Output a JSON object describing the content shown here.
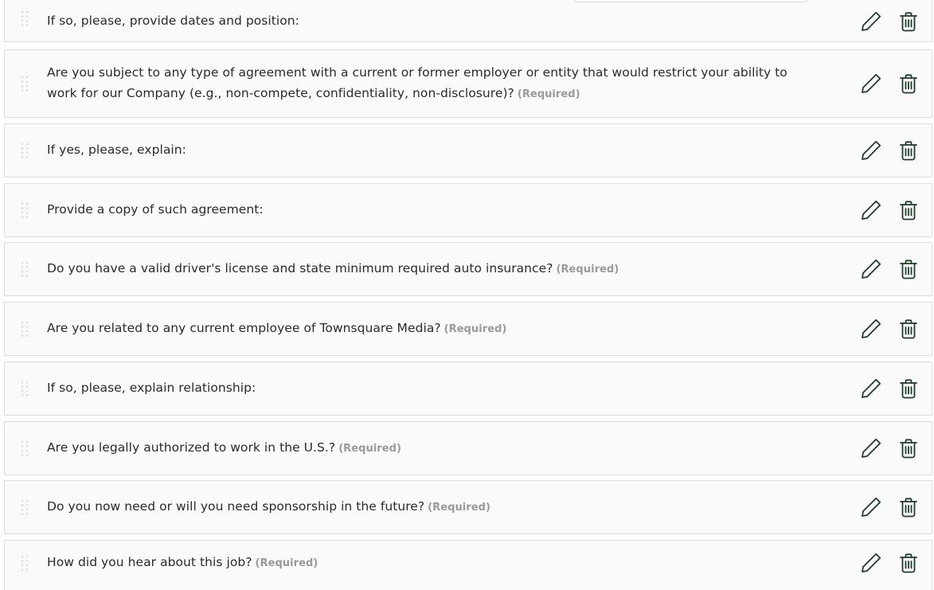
{
  "questions": [
    {
      "text": "If so, please, provide dates and position:",
      "required": ""
    },
    {
      "text": "Are you subject to any type of agreement with a current or former employer or entity that would restrict your ability to work for our Company (e.g., non-compete, confidentiality, non-disclosure)?",
      "required": "(Required)"
    },
    {
      "text": "If yes, please, explain:",
      "required": ""
    },
    {
      "text": "Provide a copy of such agreement:",
      "required": ""
    },
    {
      "text": "Do you have a valid driver's license and state minimum required auto insurance?",
      "required": "(Required)"
    },
    {
      "text": "Are you related to any current employee of Townsquare Media?",
      "required": "(Required)"
    },
    {
      "text": "If so, please, explain relationship:",
      "required": ""
    },
    {
      "text": "Are you legally authorized to work in the U.S.?",
      "required": "(Required)"
    },
    {
      "text": "Do you now need or will you need sponsorship in the future?",
      "required": "(Required)"
    },
    {
      "text": "How did you hear about this job?",
      "required": "(Required)"
    }
  ],
  "icons": {
    "drag": "drag-handle-icon",
    "edit": "pencil-icon",
    "delete": "trash-icon"
  },
  "colors": {
    "icon": "#1f3d2b",
    "required": "#9a9a9a",
    "row_bg": "#fafafa",
    "row_border": "#dcdcdc"
  }
}
